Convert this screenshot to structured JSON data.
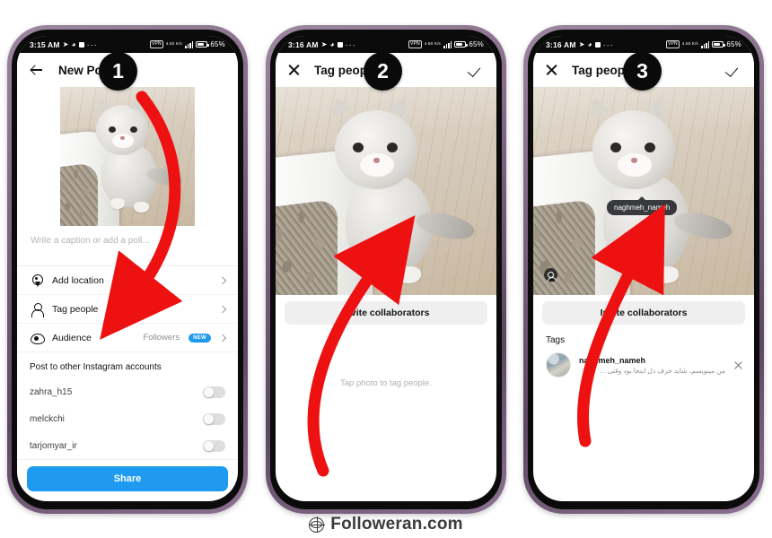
{
  "footer": {
    "brand": "Followeran.com",
    "icon": "globe-icon"
  },
  "steps": {
    "one": "1",
    "two": "2",
    "three": "3"
  },
  "phone1": {
    "status": {
      "time": "3:15 AM",
      "battery_pct": "65%",
      "vpn": "VPN",
      "rate": "4.50 K/s",
      "icons": [
        "send-icon",
        "message-icon",
        "square-icon",
        "more-dots-icon"
      ]
    },
    "header": {
      "back_icon": "back-arrow-icon",
      "title": "New Post"
    },
    "caption": {
      "placeholder": "Write a caption or add a poll..."
    },
    "options": [
      {
        "icon": "location-pin-icon",
        "label": "Add location",
        "value": "",
        "badge": ""
      },
      {
        "icon": "person-icon",
        "label": "Tag people",
        "value": "",
        "badge": ""
      },
      {
        "icon": "audience-eye-icon",
        "label": "Audience",
        "value": "Followers",
        "badge": "NEW"
      }
    ],
    "accounts_title": "Post to other Instagram accounts",
    "accounts": [
      {
        "name": "zahra_h15",
        "enabled": false
      },
      {
        "name": "melckchi",
        "enabled": false
      },
      {
        "name": "tarjomyar_ir",
        "enabled": false
      }
    ],
    "share_label": "Share"
  },
  "phone2": {
    "status": {
      "time": "3:16 AM",
      "battery_pct": "65%",
      "vpn": "VPN",
      "rate": "4.50 K/s"
    },
    "header": {
      "close_icon": "close-icon",
      "title": "Tag people",
      "confirm_icon": "check-icon"
    },
    "invite_label": "Invite collaborators",
    "hint": "Tap photo to tag people."
  },
  "phone3": {
    "status": {
      "time": "3:16 AM",
      "battery_pct": "65%",
      "vpn": "VPN",
      "rate": "4.50 K/s"
    },
    "header": {
      "close_icon": "close-icon",
      "title": "Tag people",
      "confirm_icon": "check-icon"
    },
    "photo_tag_pill": "naghmeh_nameh",
    "invite_label": "Invite collaborators",
    "tags_title": "Tags",
    "tag_entry": {
      "username": "naghmeh_nameh",
      "subtitle": "من مینویسم، شاید حرف دل اینجا بود وقتی ...",
      "remove_icon": "close-icon"
    }
  }
}
